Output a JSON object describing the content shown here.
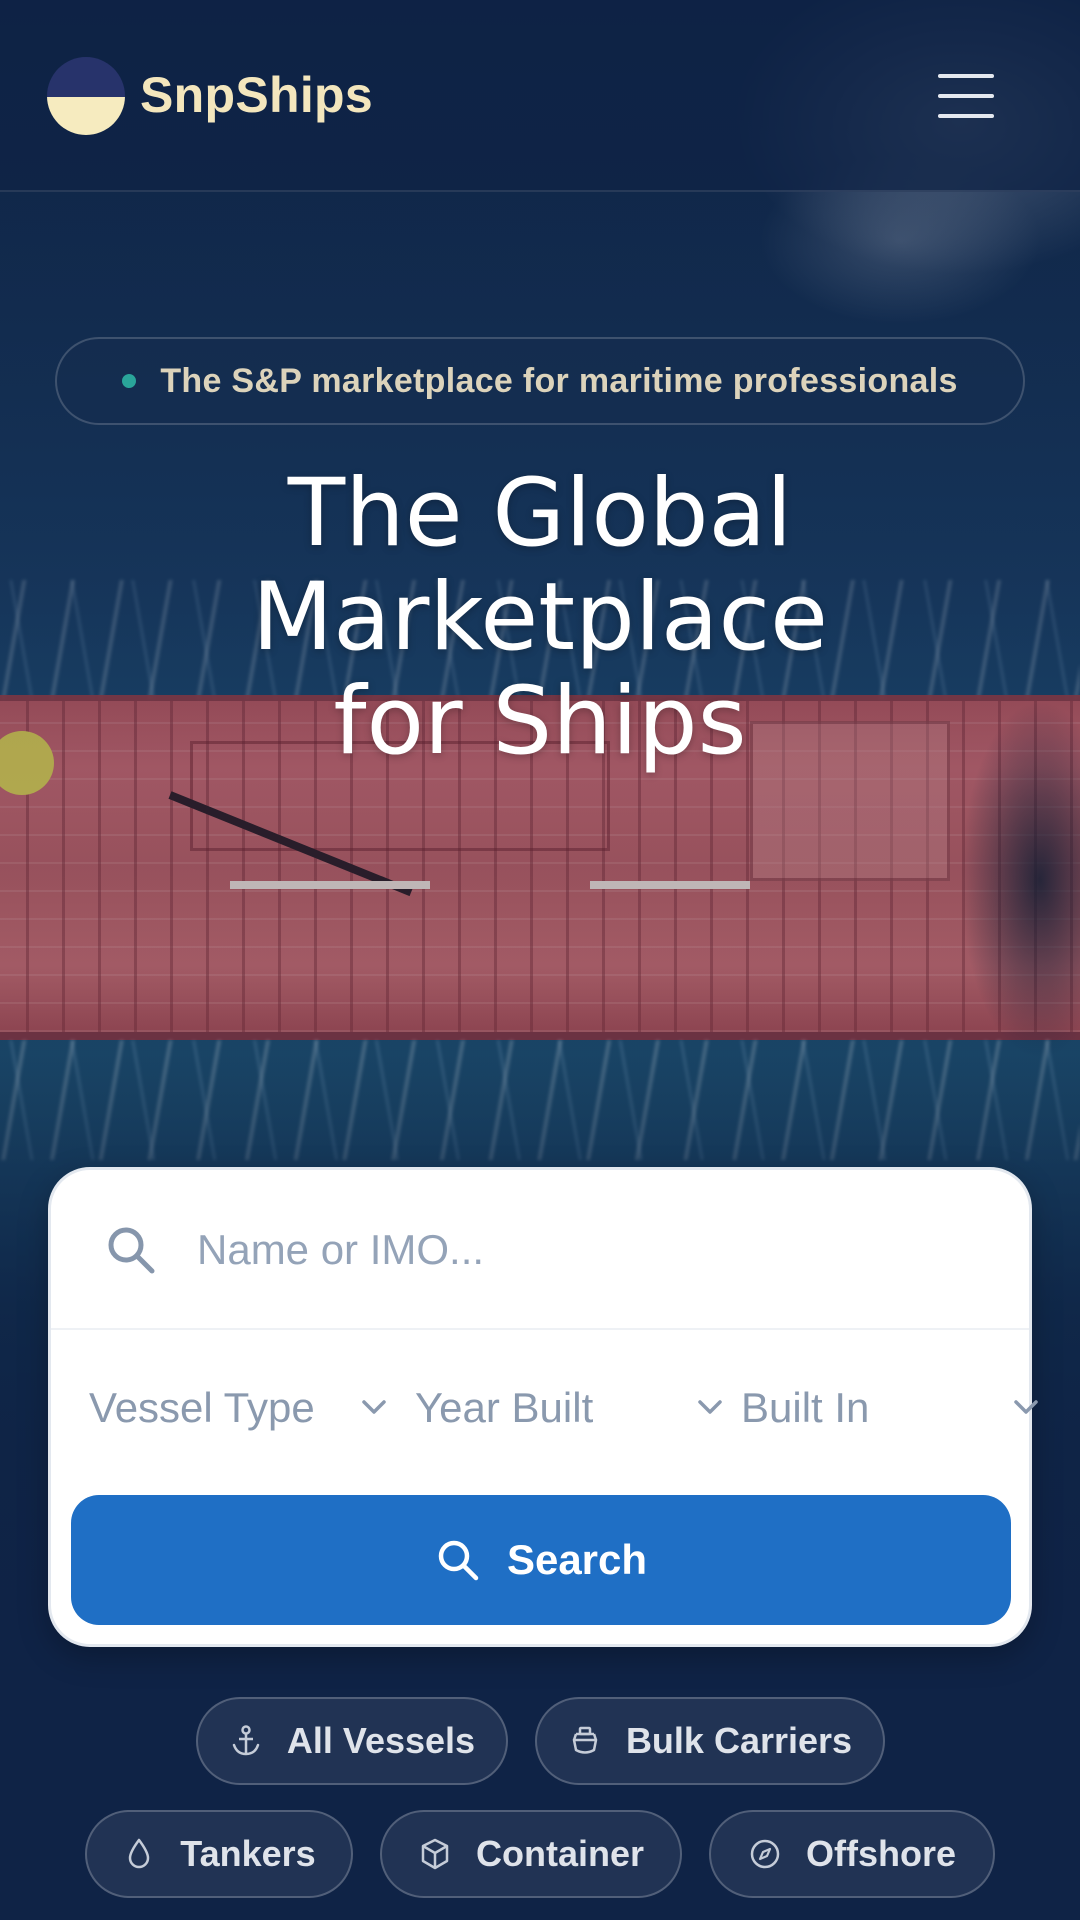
{
  "header": {
    "brand": "SnpShips",
    "menu_icon": "hamburger-menu-icon"
  },
  "hero": {
    "tagline": "The S&P marketplace for maritime professionals",
    "headline_lines": [
      "The Global",
      "Marketplace",
      "for Ships"
    ]
  },
  "search": {
    "placeholder": "Name or IMO...",
    "value": "",
    "filters": [
      {
        "label": "Vessel Type"
      },
      {
        "label": "Year Built"
      },
      {
        "label": "Built In"
      }
    ],
    "button_label": "Search"
  },
  "categories": [
    {
      "label": "All Vessels",
      "icon": "anchor-icon"
    },
    {
      "label": "Bulk Carriers",
      "icon": "ship-icon"
    },
    {
      "label": "Tankers",
      "icon": "droplet-icon"
    },
    {
      "label": "Container",
      "icon": "box-icon"
    },
    {
      "label": "Offshore",
      "icon": "compass-icon"
    }
  ],
  "colors": {
    "primary_button": "#1f6fc5",
    "brand_text": "#f3e6bd",
    "background": "#0f2346",
    "status_dot": "#2aa59a"
  }
}
